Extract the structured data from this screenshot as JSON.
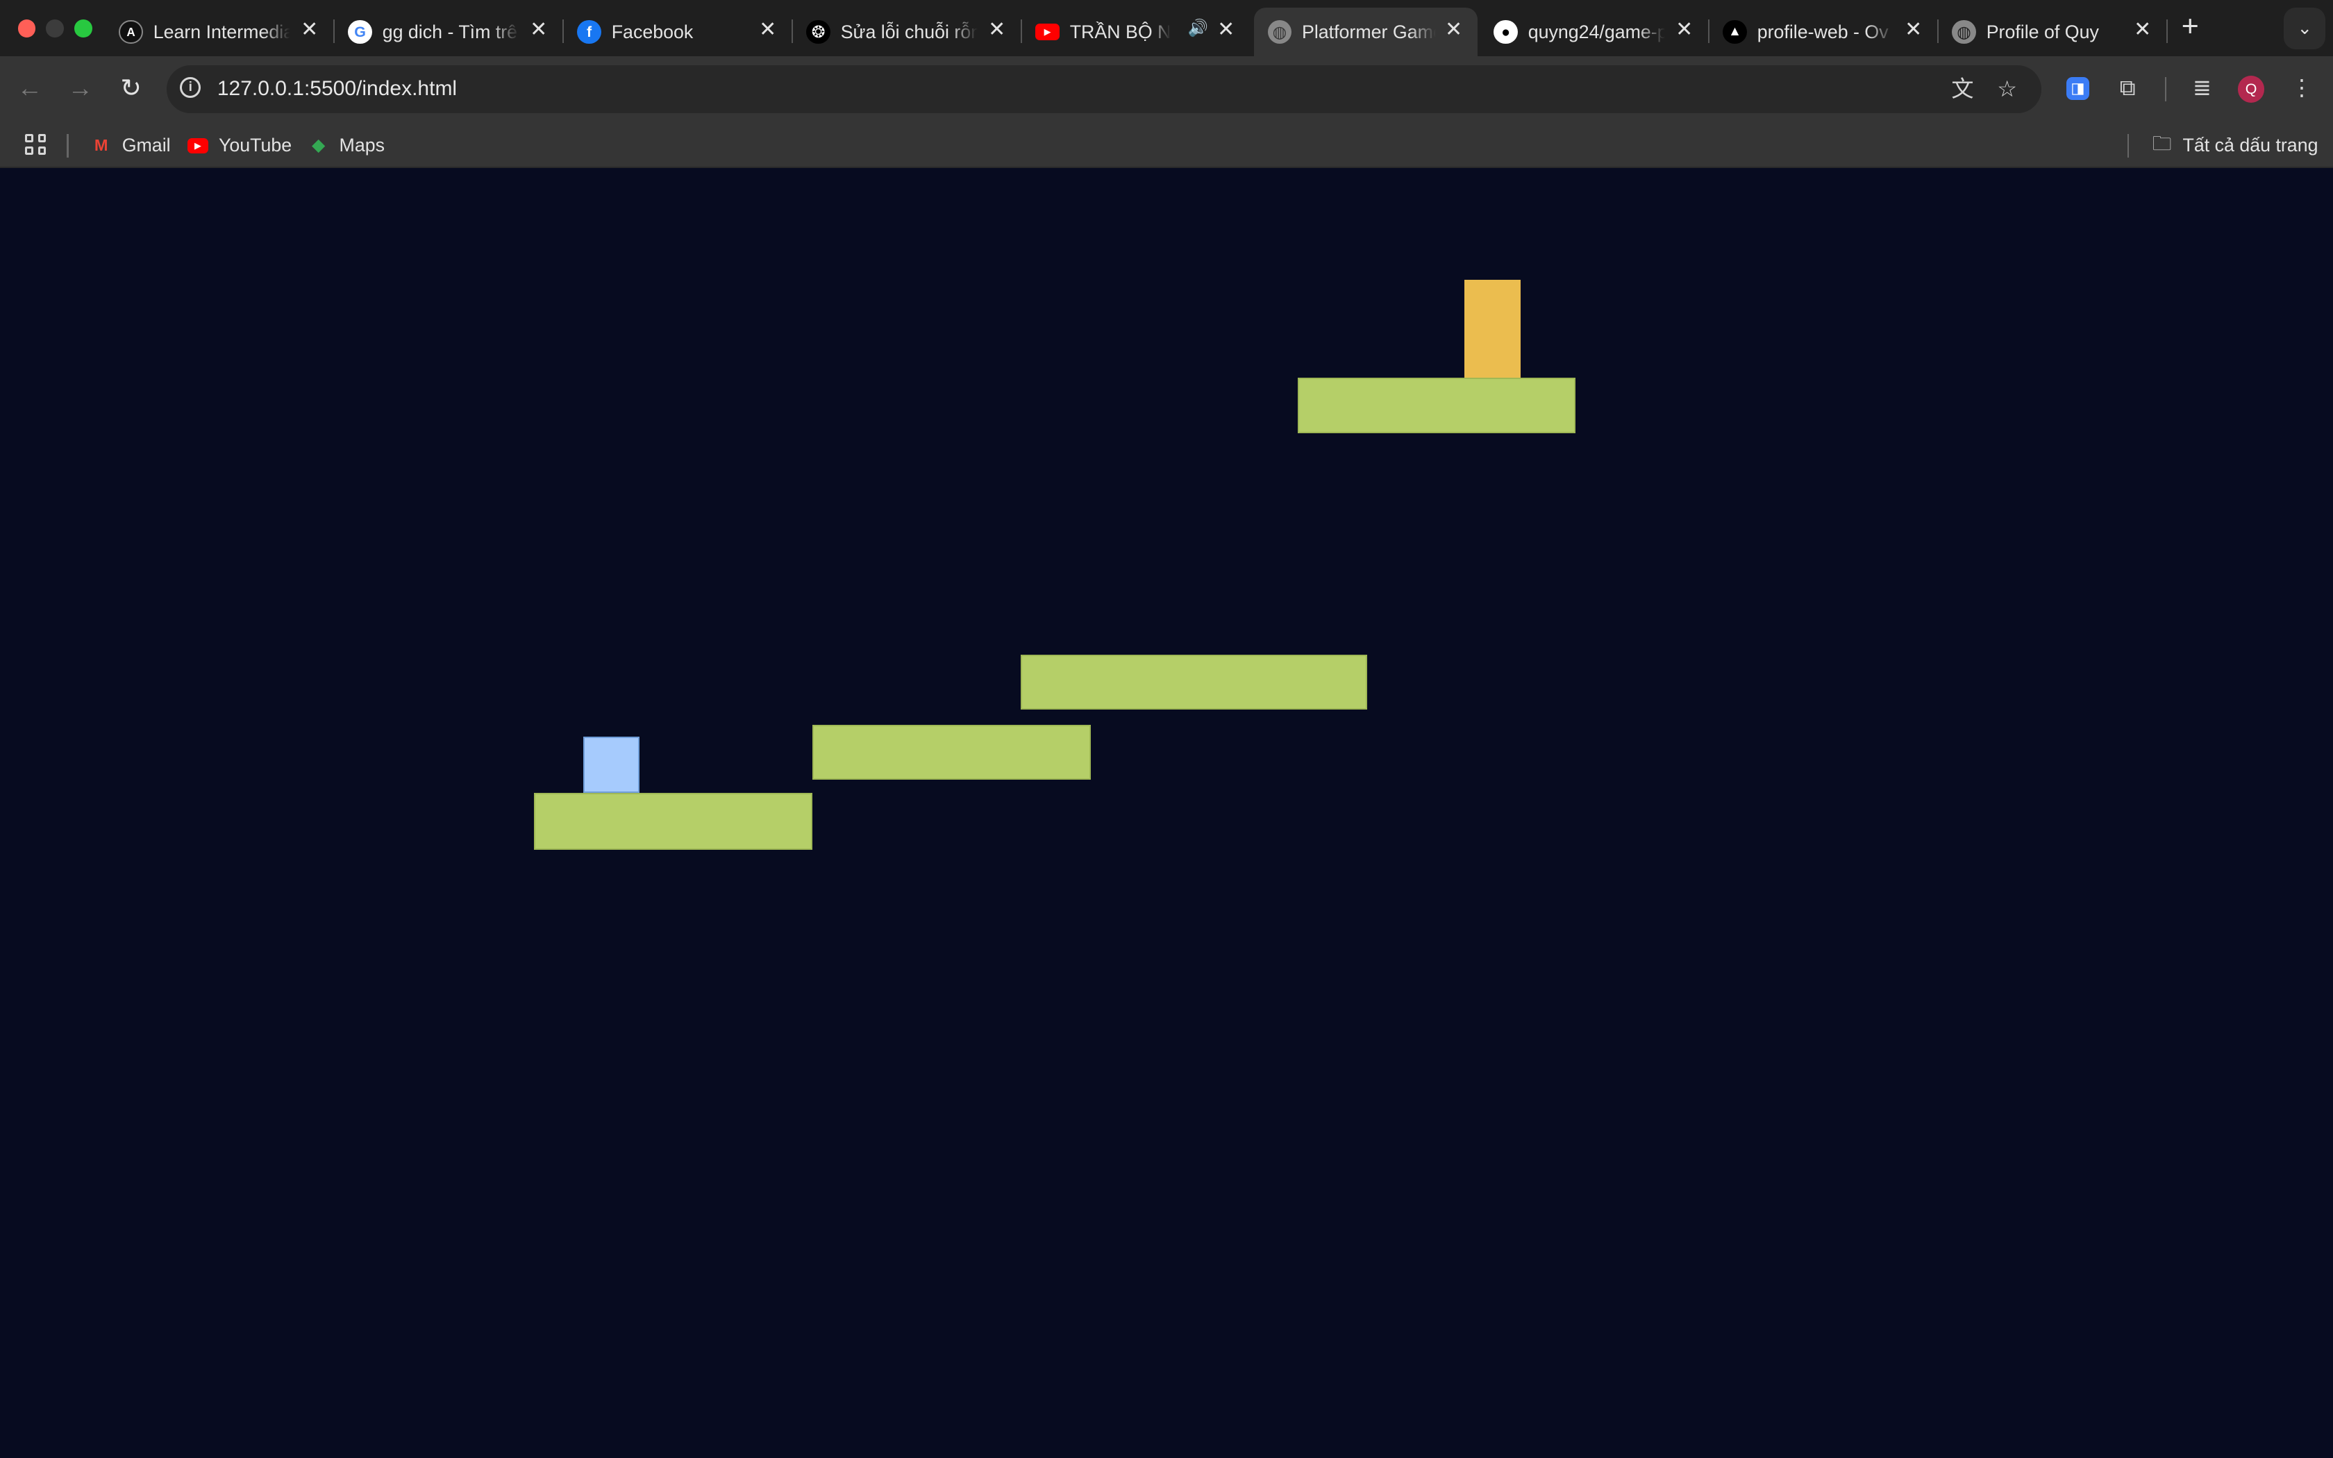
{
  "window": {
    "tabs": [
      {
        "title": "Learn Intermedia",
        "icon": "astro-icon",
        "active": false
      },
      {
        "title": "gg dich - Tìm trê",
        "icon": "google-icon",
        "active": false
      },
      {
        "title": "Facebook",
        "icon": "facebook-icon",
        "active": false
      },
      {
        "title": "Sửa lỗi chuỗi rỗn",
        "icon": "chatgpt-icon",
        "active": false
      },
      {
        "title": "TRẦN BỘ NH",
        "icon": "youtube-icon",
        "active": false,
        "playing_audio": true
      },
      {
        "title": "Platformer Game",
        "icon": "globe-icon",
        "active": true
      },
      {
        "title": "quyng24/game-p",
        "icon": "github-icon",
        "active": false
      },
      {
        "title": "profile-web - Ov",
        "icon": "vercel-icon",
        "active": false
      },
      {
        "title": "Profile of Quy",
        "icon": "globe-icon",
        "active": false
      }
    ]
  },
  "toolbar": {
    "url": "127.0.0.1:5500/index.html",
    "avatar_initial": "Q"
  },
  "bookmarks": {
    "items": [
      {
        "label": "Gmail",
        "icon": "gmail-icon"
      },
      {
        "label": "YouTube",
        "icon": "youtube-icon"
      },
      {
        "label": "Maps",
        "icon": "maps-icon"
      }
    ],
    "all_bookmarks_label": "Tất cả dấu trang"
  },
  "game": {
    "background_color": "#070b20",
    "platform_color": "#b5cf68",
    "player_color": "#a6cbfd",
    "goal_color": "#ebbd4f"
  }
}
